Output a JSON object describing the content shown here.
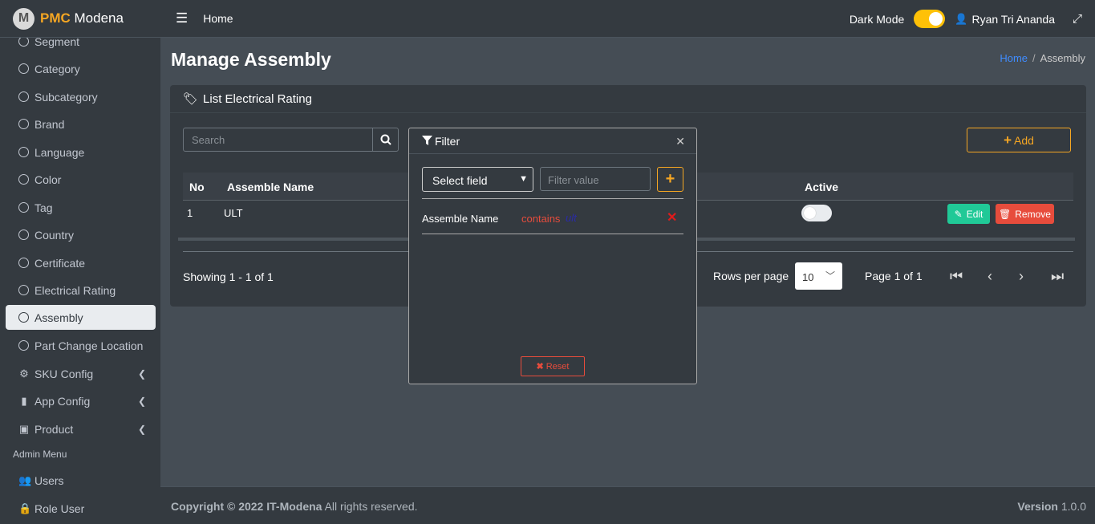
{
  "brand": {
    "logo_letter": "M",
    "name_bold": "PMC",
    "name_rest": " Modena"
  },
  "sidebar": {
    "items": [
      {
        "label": "Segment"
      },
      {
        "label": "Category"
      },
      {
        "label": "Subcategory"
      },
      {
        "label": "Brand"
      },
      {
        "label": "Language"
      },
      {
        "label": "Color"
      },
      {
        "label": "Tag"
      },
      {
        "label": "Country"
      },
      {
        "label": "Certificate"
      },
      {
        "label": "Electrical Rating"
      },
      {
        "label": "Assembly"
      },
      {
        "label": "Part Change Location"
      }
    ],
    "groups": [
      {
        "label": "SKU Config",
        "icon": "gear-icon"
      },
      {
        "label": "App Config",
        "icon": "mobile-icon"
      },
      {
        "label": "Product",
        "icon": "briefcase-icon"
      }
    ],
    "admin_header": "Admin Menu",
    "admin_items": [
      {
        "label": "Users",
        "icon": "users-cog-icon"
      },
      {
        "label": "Role User",
        "icon": "lock-icon"
      }
    ]
  },
  "topbar": {
    "home": "Home",
    "dark_mode": "Dark Mode",
    "user": "Ryan Tri Ananda"
  },
  "page": {
    "title": "Manage Assembly",
    "breadcrumb_home": "Home",
    "breadcrumb_current": "Assembly"
  },
  "card": {
    "title": "List Electrical Rating",
    "search_placeholder": "Search",
    "add_label": "Add",
    "columns": {
      "no": "No",
      "name": "Assemble Name",
      "active": "Active"
    },
    "rows": [
      {
        "no": "1",
        "name": "ULT",
        "active": false
      }
    ],
    "edit_label": "Edit",
    "remove_label": "Remove",
    "showing": "Showing 1 - 1 of 1",
    "rows_per_page_label": "Rows per page",
    "rows_per_page": "10",
    "page_label": "Page 1 of 1"
  },
  "filter": {
    "title": "Filter",
    "select_field": "Select field",
    "value_placeholder": "Filter value",
    "condition": {
      "field": "Assemble Name",
      "operator": "contains",
      "value": "ult"
    },
    "reset_label": "Reset"
  },
  "footer": {
    "copyright_bold": "Copyright © 2022 IT-Modena",
    "copyright_rest": " All rights reserved.",
    "version_label": "Version",
    "version": " 1.0.0"
  }
}
